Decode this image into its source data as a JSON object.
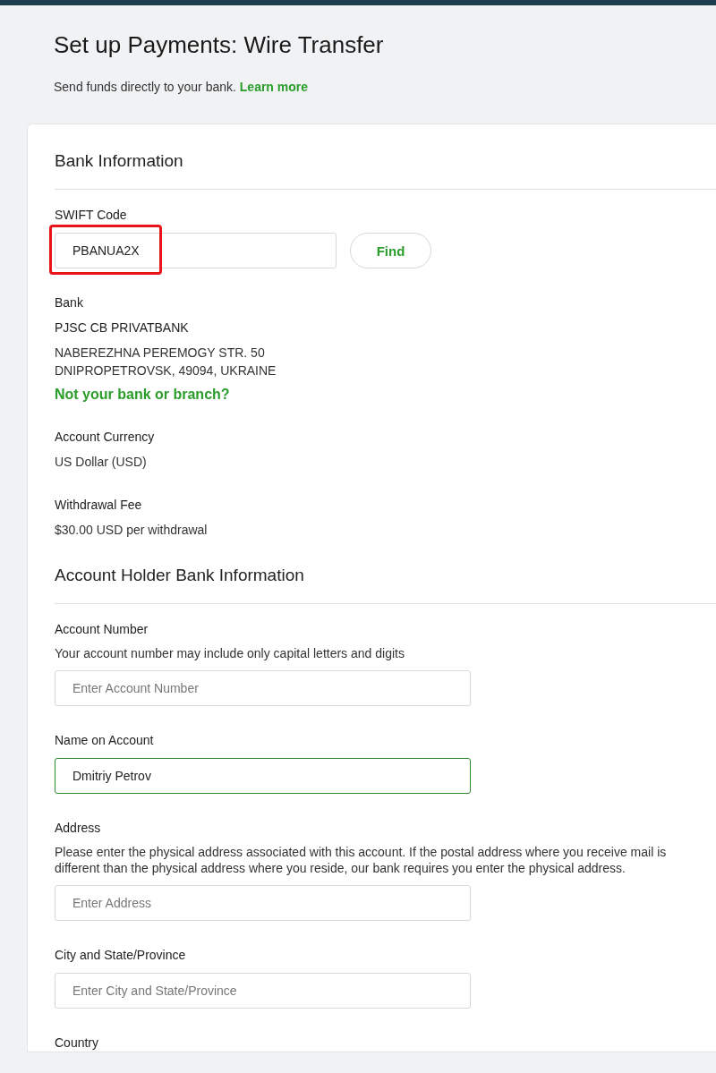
{
  "page": {
    "title": "Set up Payments: Wire Transfer",
    "subtitle": "Send funds directly to your bank.",
    "learn_more": "Learn more"
  },
  "sections": [
    {
      "heading": "Bank Information",
      "items": [
        {
          "kind": "lookup",
          "label": "SWIFT Code",
          "value": "PBANUA2X",
          "highlighted": true,
          "button": "Find"
        },
        {
          "kind": "bank",
          "label": "Bank",
          "name": "PJSC CB PRIVATBANK",
          "address_lines": [
            "NABEREZHNA PEREMOGY STR. 50",
            "DNIPROPETROVSK, 49094, UKRAINE"
          ],
          "link": "Not your bank or branch?"
        },
        {
          "kind": "info",
          "label": "Account Currency",
          "value": "US Dollar (USD)"
        },
        {
          "kind": "info",
          "label": "Withdrawal Fee",
          "value": "$30.00 USD per withdrawal"
        }
      ]
    },
    {
      "heading": "Account Holder Bank Information",
      "items": [
        {
          "kind": "input",
          "label": "Account Number",
          "hint": "Your account number may include only capital letters and digits",
          "placeholder": "Enter Account Number",
          "focused": false
        },
        {
          "kind": "input",
          "label": "Name on Account",
          "value": "Dmitriy Petrov",
          "focused": true
        },
        {
          "kind": "input",
          "label": "Address",
          "hint": "Please enter the physical address associated with this account. If the postal address where you receive mail is different than the physical address where you reside, our bank requires you enter the physical address.",
          "placeholder": "Enter Address",
          "focused": false
        },
        {
          "kind": "input",
          "label": "City and State/Province",
          "placeholder": "Enter City and State/Province",
          "focused": false
        },
        {
          "kind": "label",
          "label": "Country"
        }
      ]
    }
  ]
}
